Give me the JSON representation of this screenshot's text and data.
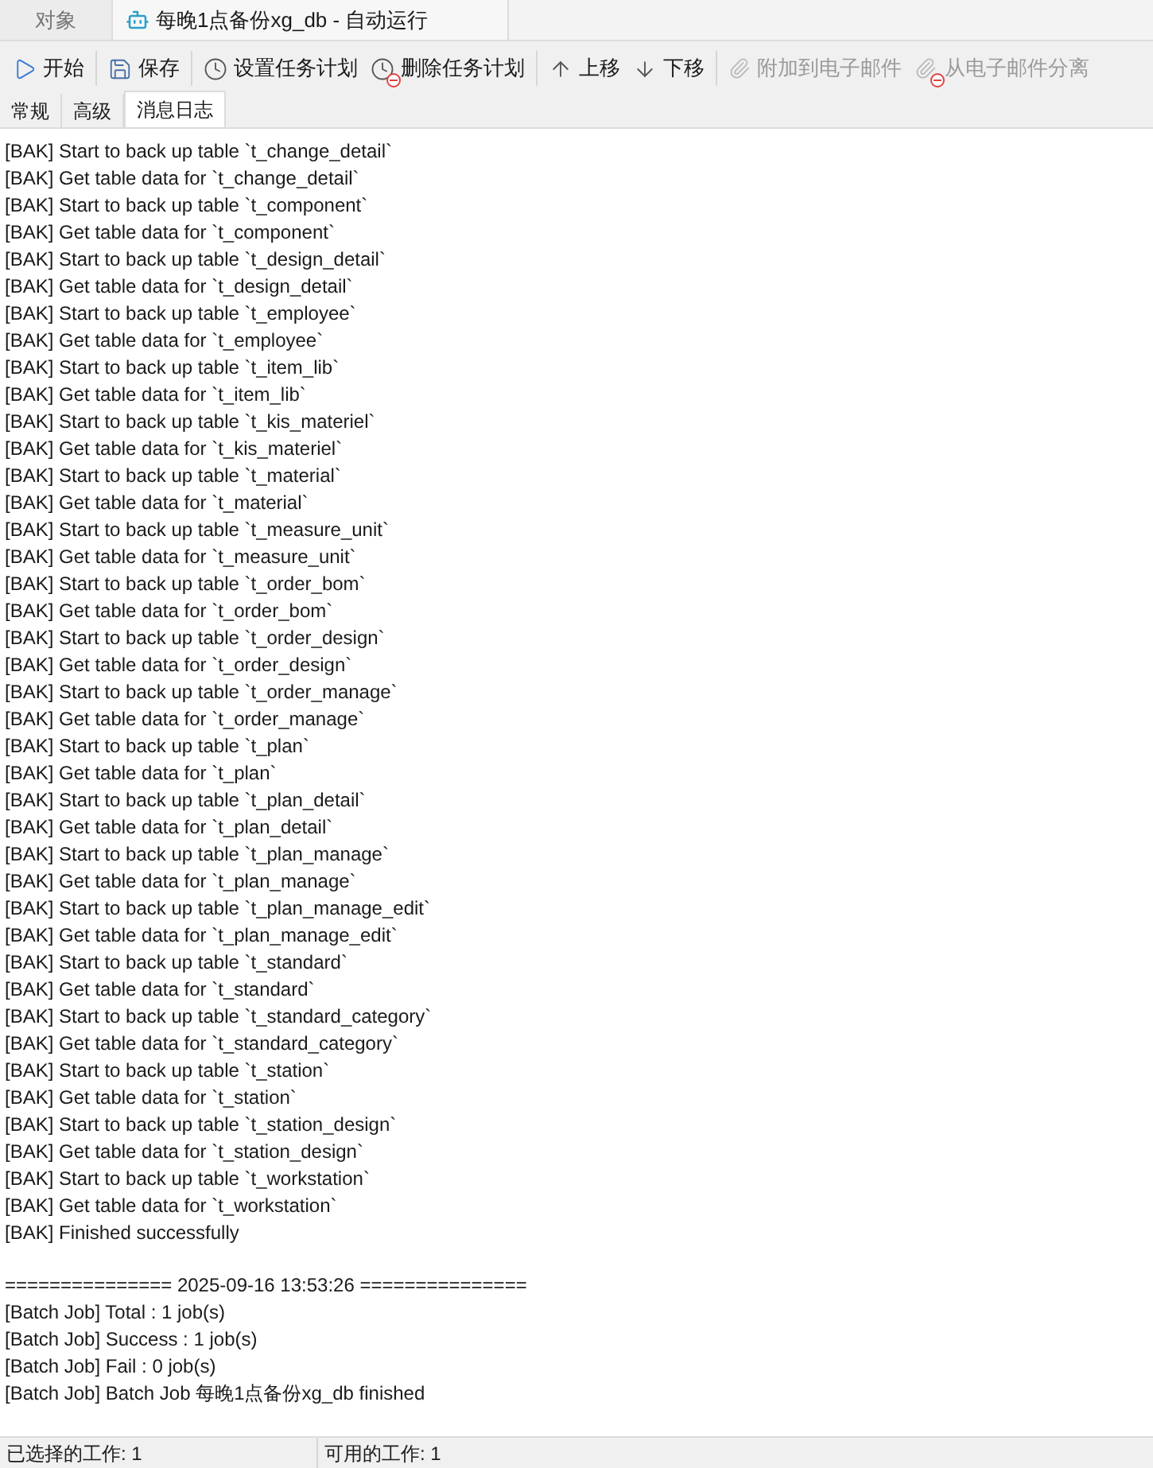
{
  "document_tabs": [
    {
      "label": "对象",
      "selected": false,
      "kind": "plain"
    },
    {
      "label": "每晚1点备份xg_db - 自动运行",
      "selected": true,
      "kind": "task"
    }
  ],
  "toolbar": [
    {
      "label": "开始",
      "kind": "play",
      "disabled": false,
      "separator_after": true
    },
    {
      "label": "保存",
      "kind": "save",
      "disabled": false,
      "separator_after": true
    },
    {
      "label": "设置任务计划",
      "kind": "clock",
      "disabled": false,
      "separator_after": false
    },
    {
      "label": "删除任务计划",
      "kind": "clock-delete",
      "disabled": false,
      "separator_after": true
    },
    {
      "label": "上移",
      "kind": "up",
      "disabled": false,
      "separator_after": false
    },
    {
      "label": "下移",
      "kind": "down",
      "disabled": false,
      "separator_after": true
    },
    {
      "label": "附加到电子邮件",
      "kind": "clip",
      "disabled": true,
      "separator_after": false
    },
    {
      "label": "从电子邮件分离",
      "kind": "clip-delete",
      "disabled": true,
      "separator_after": false
    }
  ],
  "sub_tabs": [
    {
      "label": "常规",
      "selected": false
    },
    {
      "label": "高级",
      "selected": false
    },
    {
      "label": "消息日志",
      "selected": true
    }
  ],
  "log": {
    "lines": [
      "[BAK] Start to back up table `t_change_detail`",
      "[BAK] Get table data for `t_change_detail`",
      "[BAK] Start to back up table `t_component`",
      "[BAK] Get table data for `t_component`",
      "[BAK] Start to back up table `t_design_detail`",
      "[BAK] Get table data for `t_design_detail`",
      "[BAK] Start to back up table `t_employee`",
      "[BAK] Get table data for `t_employee`",
      "[BAK] Start to back up table `t_item_lib`",
      "[BAK] Get table data for `t_item_lib`",
      "[BAK] Start to back up table `t_kis_materiel`",
      "[BAK] Get table data for `t_kis_materiel`",
      "[BAK] Start to back up table `t_material`",
      "[BAK] Get table data for `t_material`",
      "[BAK] Start to back up table `t_measure_unit`",
      "[BAK] Get table data for `t_measure_unit`",
      "[BAK] Start to back up table `t_order_bom`",
      "[BAK] Get table data for `t_order_bom`",
      "[BAK] Start to back up table `t_order_design`",
      "[BAK] Get table data for `t_order_design`",
      "[BAK] Start to back up table `t_order_manage`",
      "[BAK] Get table data for `t_order_manage`",
      "[BAK] Start to back up table `t_plan`",
      "[BAK] Get table data for `t_plan`",
      "[BAK] Start to back up table `t_plan_detail`",
      "[BAK] Get table data for `t_plan_detail`",
      "[BAK] Start to back up table `t_plan_manage`",
      "[BAK] Get table data for `t_plan_manage`",
      "[BAK] Start to back up table `t_plan_manage_edit`",
      "[BAK] Get table data for `t_plan_manage_edit`",
      "[BAK] Start to back up table `t_standard`",
      "[BAK] Get table data for `t_standard`",
      "[BAK] Start to back up table `t_standard_category`",
      "[BAK] Get table data for `t_standard_category`",
      "[BAK] Start to back up table `t_station`",
      "[BAK] Get table data for `t_station`",
      "[BAK] Start to back up table `t_station_design`",
      "[BAK] Get table data for `t_station_design`",
      "[BAK] Start to back up table `t_workstation`",
      "[BAK] Get table data for `t_workstation`",
      "[BAK] Finished successfully"
    ],
    "summary_lines": [
      "=============== 2025-09-16 13:53:26 ===============",
      "[Batch Job] Total : 1 job(s)",
      "[Batch Job] Success : 1 job(s)",
      "[Batch Job] Fail : 0 job(s)",
      "[Batch Job] Batch Job 每晚1点备份xg_db finished"
    ]
  },
  "status_bar": [
    "已选择的工作: 1",
    "可用的工作: 1"
  ]
}
